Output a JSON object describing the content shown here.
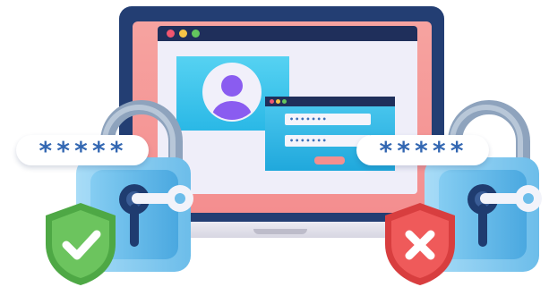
{
  "left_password": {
    "text": "*****",
    "status": "valid"
  },
  "right_password": {
    "text": "*****",
    "status": "invalid"
  },
  "login_form": {
    "username_field": "•••••••",
    "password_field": "•••••••"
  },
  "colors": {
    "laptop_frame": "#233e73",
    "screen_bg": "#f48e8f",
    "card_accent": "#2ab8e6",
    "avatar": "#8a5cf0",
    "valid_shield": "#5bbb4c",
    "invalid_shield": "#e54d4d",
    "lock_blue": "#6cbdea"
  },
  "icons": {
    "valid": "check-icon",
    "invalid": "cross-icon"
  }
}
